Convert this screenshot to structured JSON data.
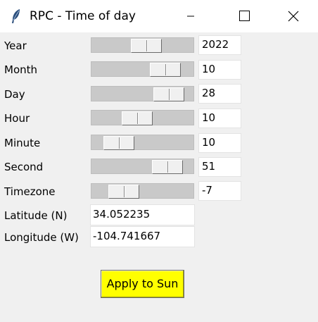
{
  "window": {
    "title": "RPC - Time of day",
    "app_icon": "feather-icon",
    "controls": [
      "minimize-icon",
      "maximize-icon",
      "close-icon"
    ]
  },
  "sliders": [
    {
      "label": "Year",
      "value": "2022",
      "level": 0.55
    },
    {
      "label": "Month",
      "value": "10",
      "level": 0.82
    },
    {
      "label": "Day",
      "value": "28",
      "level": 0.87
    },
    {
      "label": "Hour",
      "value": "10",
      "level": 0.43
    },
    {
      "label": "Minute",
      "value": "10",
      "level": 0.17
    },
    {
      "label": "Second",
      "value": "51",
      "level": 0.85
    },
    {
      "label": "Timezone",
      "value": "-7",
      "level": 0.24
    }
  ],
  "location": {
    "latitude_label": "Latitude (N)",
    "latitude_value": "34.052235",
    "longitude_label": "Longitude (W)",
    "longitude_value": "-104.741667"
  },
  "apply_button": {
    "label": "Apply to Sun",
    "color": "#ffff00"
  }
}
